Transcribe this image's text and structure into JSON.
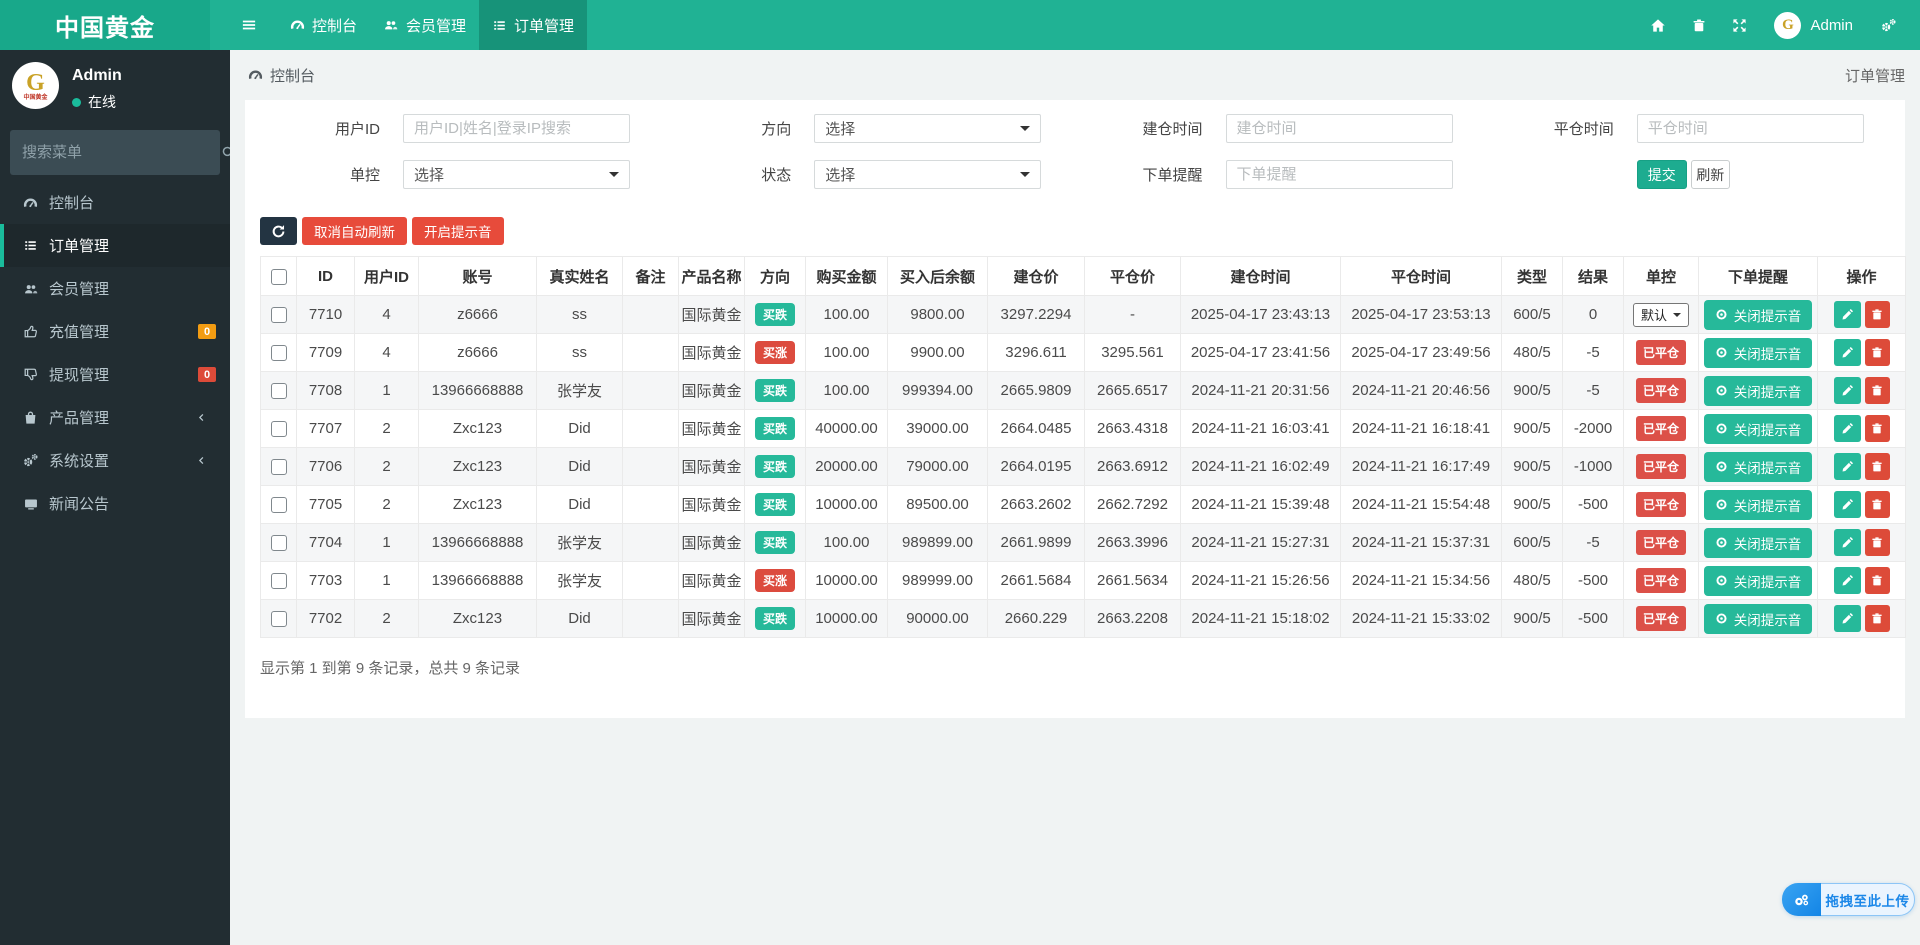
{
  "navbar": {
    "brand": "中国黄金",
    "tabs": [
      {
        "label": "控制台",
        "icon": "dashboard",
        "active": false
      },
      {
        "label": "会员管理",
        "icon": "users",
        "active": false
      },
      {
        "label": "订单管理",
        "icon": "list",
        "active": true
      }
    ],
    "user": "Admin"
  },
  "sidebar": {
    "user": {
      "name": "Admin",
      "status": "在线"
    },
    "search_placeholder": "搜索菜单",
    "items": [
      {
        "label": "控制台",
        "icon": "dashboard"
      },
      {
        "label": "订单管理",
        "icon": "list",
        "active": true
      },
      {
        "label": "会员管理",
        "icon": "users"
      },
      {
        "label": "充值管理",
        "icon": "thumbs-up",
        "badge": "0",
        "badge_color": "orange"
      },
      {
        "label": "提现管理",
        "icon": "thumbs-down",
        "badge": "0",
        "badge_color": "red"
      },
      {
        "label": "产品管理",
        "icon": "bag",
        "chevron": true
      },
      {
        "label": "系统设置",
        "icon": "cogs",
        "chevron": true
      },
      {
        "label": "新闻公告",
        "icon": "tv"
      }
    ]
  },
  "breadcrumb": {
    "left": "控制台",
    "right": "订单管理"
  },
  "filters": {
    "rows": [
      [
        {
          "label": "用户ID",
          "type": "input",
          "placeholder": "用户ID|姓名|登录IP搜索"
        },
        {
          "label": "方向",
          "type": "select",
          "value": "选择"
        },
        {
          "label": "建仓时间",
          "type": "input",
          "placeholder": "建仓时间"
        },
        {
          "label": "平仓时间",
          "type": "input",
          "placeholder": "平仓时间"
        }
      ],
      [
        {
          "label": "单控",
          "type": "select",
          "value": "选择"
        },
        {
          "label": "状态",
          "type": "select",
          "value": "选择"
        },
        {
          "label": "下单提醒",
          "type": "input",
          "placeholder": "下单提醒"
        },
        {
          "type": "buttons",
          "submit": "提交",
          "refresh": "刷新"
        }
      ]
    ]
  },
  "toolbar": {
    "cancel_auto_refresh": "取消自动刷新",
    "enable_sound": "开启提示音"
  },
  "table": {
    "columns": [
      "",
      "ID",
      "用户ID",
      "账号",
      "真实姓名",
      "备注",
      "产品名称",
      "方向",
      "购买金额",
      "买入后余额",
      "建仓价",
      "平仓价",
      "建仓时间",
      "平仓时间",
      "类型",
      "结果",
      "单控",
      "下单提醒",
      "操作"
    ],
    "rows": [
      {
        "id": "7710",
        "uid": "4",
        "account": "z6666",
        "name": "ss",
        "note": "",
        "product": "国际黄金",
        "dir": "买跌",
        "dir_color": "green",
        "amount": "100.00",
        "balance": "9800.00",
        "open_price": "3297.2294",
        "close_price": "-",
        "open_time": "2025-04-17 23:43:13",
        "close_time": "2025-04-17 23:53:13",
        "type": "600/5",
        "result": "0",
        "control_kind": "select",
        "control": "默认",
        "alert": "关闭提示音"
      },
      {
        "id": "7709",
        "uid": "4",
        "account": "z6666",
        "name": "ss",
        "note": "",
        "product": "国际黄金",
        "dir": "买涨",
        "dir_color": "red",
        "amount": "100.00",
        "balance": "9900.00",
        "open_price": "3296.611",
        "close_price": "3295.561",
        "open_time": "2025-04-17 23:41:56",
        "close_time": "2025-04-17 23:49:56",
        "type": "480/5",
        "result": "-5",
        "control_kind": "badge",
        "control": "已平仓",
        "alert": "关闭提示音"
      },
      {
        "id": "7708",
        "uid": "1",
        "account": "13966668888",
        "name": "张学友",
        "note": "",
        "product": "国际黄金",
        "dir": "买跌",
        "dir_color": "green",
        "amount": "100.00",
        "balance": "999394.00",
        "open_price": "2665.9809",
        "close_price": "2665.6517",
        "open_time": "2024-11-21 20:31:56",
        "close_time": "2024-11-21 20:46:56",
        "type": "900/5",
        "result": "-5",
        "control_kind": "badge",
        "control": "已平仓",
        "alert": "关闭提示音"
      },
      {
        "id": "7707",
        "uid": "2",
        "account": "Zxc123",
        "name": "Did",
        "note": "",
        "product": "国际黄金",
        "dir": "买跌",
        "dir_color": "green",
        "amount": "40000.00",
        "balance": "39000.00",
        "open_price": "2664.0485",
        "close_price": "2663.4318",
        "open_time": "2024-11-21 16:03:41",
        "close_time": "2024-11-21 16:18:41",
        "type": "900/5",
        "result": "-2000",
        "control_kind": "badge",
        "control": "已平仓",
        "alert": "关闭提示音"
      },
      {
        "id": "7706",
        "uid": "2",
        "account": "Zxc123",
        "name": "Did",
        "note": "",
        "product": "国际黄金",
        "dir": "买跌",
        "dir_color": "green",
        "amount": "20000.00",
        "balance": "79000.00",
        "open_price": "2664.0195",
        "close_price": "2663.6912",
        "open_time": "2024-11-21 16:02:49",
        "close_time": "2024-11-21 16:17:49",
        "type": "900/5",
        "result": "-1000",
        "control_kind": "badge",
        "control": "已平仓",
        "alert": "关闭提示音"
      },
      {
        "id": "7705",
        "uid": "2",
        "account": "Zxc123",
        "name": "Did",
        "note": "",
        "product": "国际黄金",
        "dir": "买跌",
        "dir_color": "green",
        "amount": "10000.00",
        "balance": "89500.00",
        "open_price": "2663.2602",
        "close_price": "2662.7292",
        "open_time": "2024-11-21 15:39:48",
        "close_time": "2024-11-21 15:54:48",
        "type": "900/5",
        "result": "-500",
        "control_kind": "badge",
        "control": "已平仓",
        "alert": "关闭提示音"
      },
      {
        "id": "7704",
        "uid": "1",
        "account": "13966668888",
        "name": "张学友",
        "note": "",
        "product": "国际黄金",
        "dir": "买跌",
        "dir_color": "green",
        "amount": "100.00",
        "balance": "989899.00",
        "open_price": "2661.9899",
        "close_price": "2663.3996",
        "open_time": "2024-11-21 15:27:31",
        "close_time": "2024-11-21 15:37:31",
        "type": "600/5",
        "result": "-5",
        "control_kind": "badge",
        "control": "已平仓",
        "alert": "关闭提示音"
      },
      {
        "id": "7703",
        "uid": "1",
        "account": "13966668888",
        "name": "张学友",
        "note": "",
        "product": "国际黄金",
        "dir": "买涨",
        "dir_color": "red",
        "amount": "10000.00",
        "balance": "989999.00",
        "open_price": "2661.5684",
        "close_price": "2661.5634",
        "open_time": "2024-11-21 15:26:56",
        "close_time": "2024-11-21 15:34:56",
        "type": "480/5",
        "result": "-500",
        "control_kind": "badge",
        "control": "已平仓",
        "alert": "关闭提示音"
      },
      {
        "id": "7702",
        "uid": "2",
        "account": "Zxc123",
        "name": "Did",
        "note": "",
        "product": "国际黄金",
        "dir": "买跌",
        "dir_color": "green",
        "amount": "10000.00",
        "balance": "90000.00",
        "open_price": "2660.229",
        "close_price": "2663.2208",
        "open_time": "2024-11-21 15:18:02",
        "close_time": "2024-11-21 15:33:02",
        "type": "900/5",
        "result": "-500",
        "control_kind": "badge",
        "control": "已平仓",
        "alert": "关闭提示音"
      }
    ]
  },
  "summary": "显示第 1 到第 9 条记录，总共 9 条记录",
  "uploader": {
    "label": "拖拽至此上传"
  },
  "colors": {
    "navbar": "#20b294",
    "brand": "#18a88a",
    "sidebar": "#222d32",
    "teal": "#26b99a",
    "red": "#e74b3b",
    "danger_badge": "#dc5048",
    "orange_badge": "#f39c12",
    "uploader_blue": "#1b87e8"
  }
}
